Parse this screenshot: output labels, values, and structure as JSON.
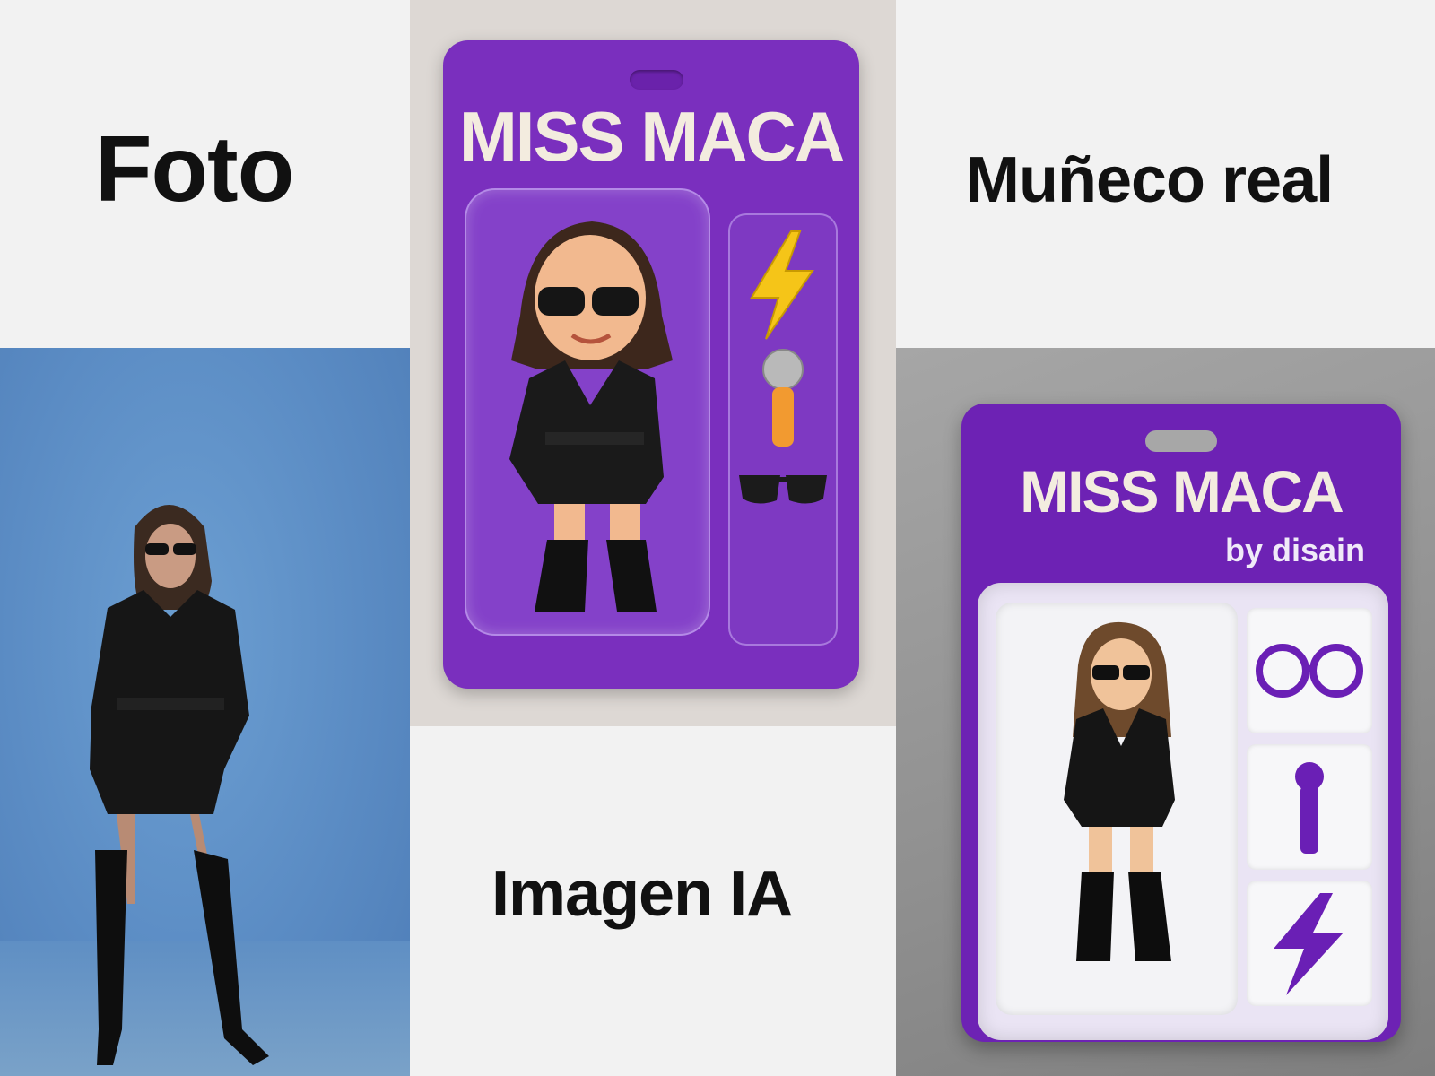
{
  "labels": {
    "photo": "Foto",
    "ai_image": "Imagen IA",
    "real_doll": "Muñeco real"
  },
  "ai_package": {
    "brand": "MISS MACA",
    "accessories": [
      "lightning-icon",
      "microphone-icon",
      "sunglasses-icon"
    ],
    "card_color": "#7a2fbe"
  },
  "real_package": {
    "brand": "MISS MACA",
    "by_line": "by disain",
    "accessories": [
      "glasses-icon",
      "microphone-icon",
      "lightning-icon"
    ],
    "card_color": "#6d22b4"
  },
  "photo": {
    "background_color": "#5b8cc4"
  }
}
